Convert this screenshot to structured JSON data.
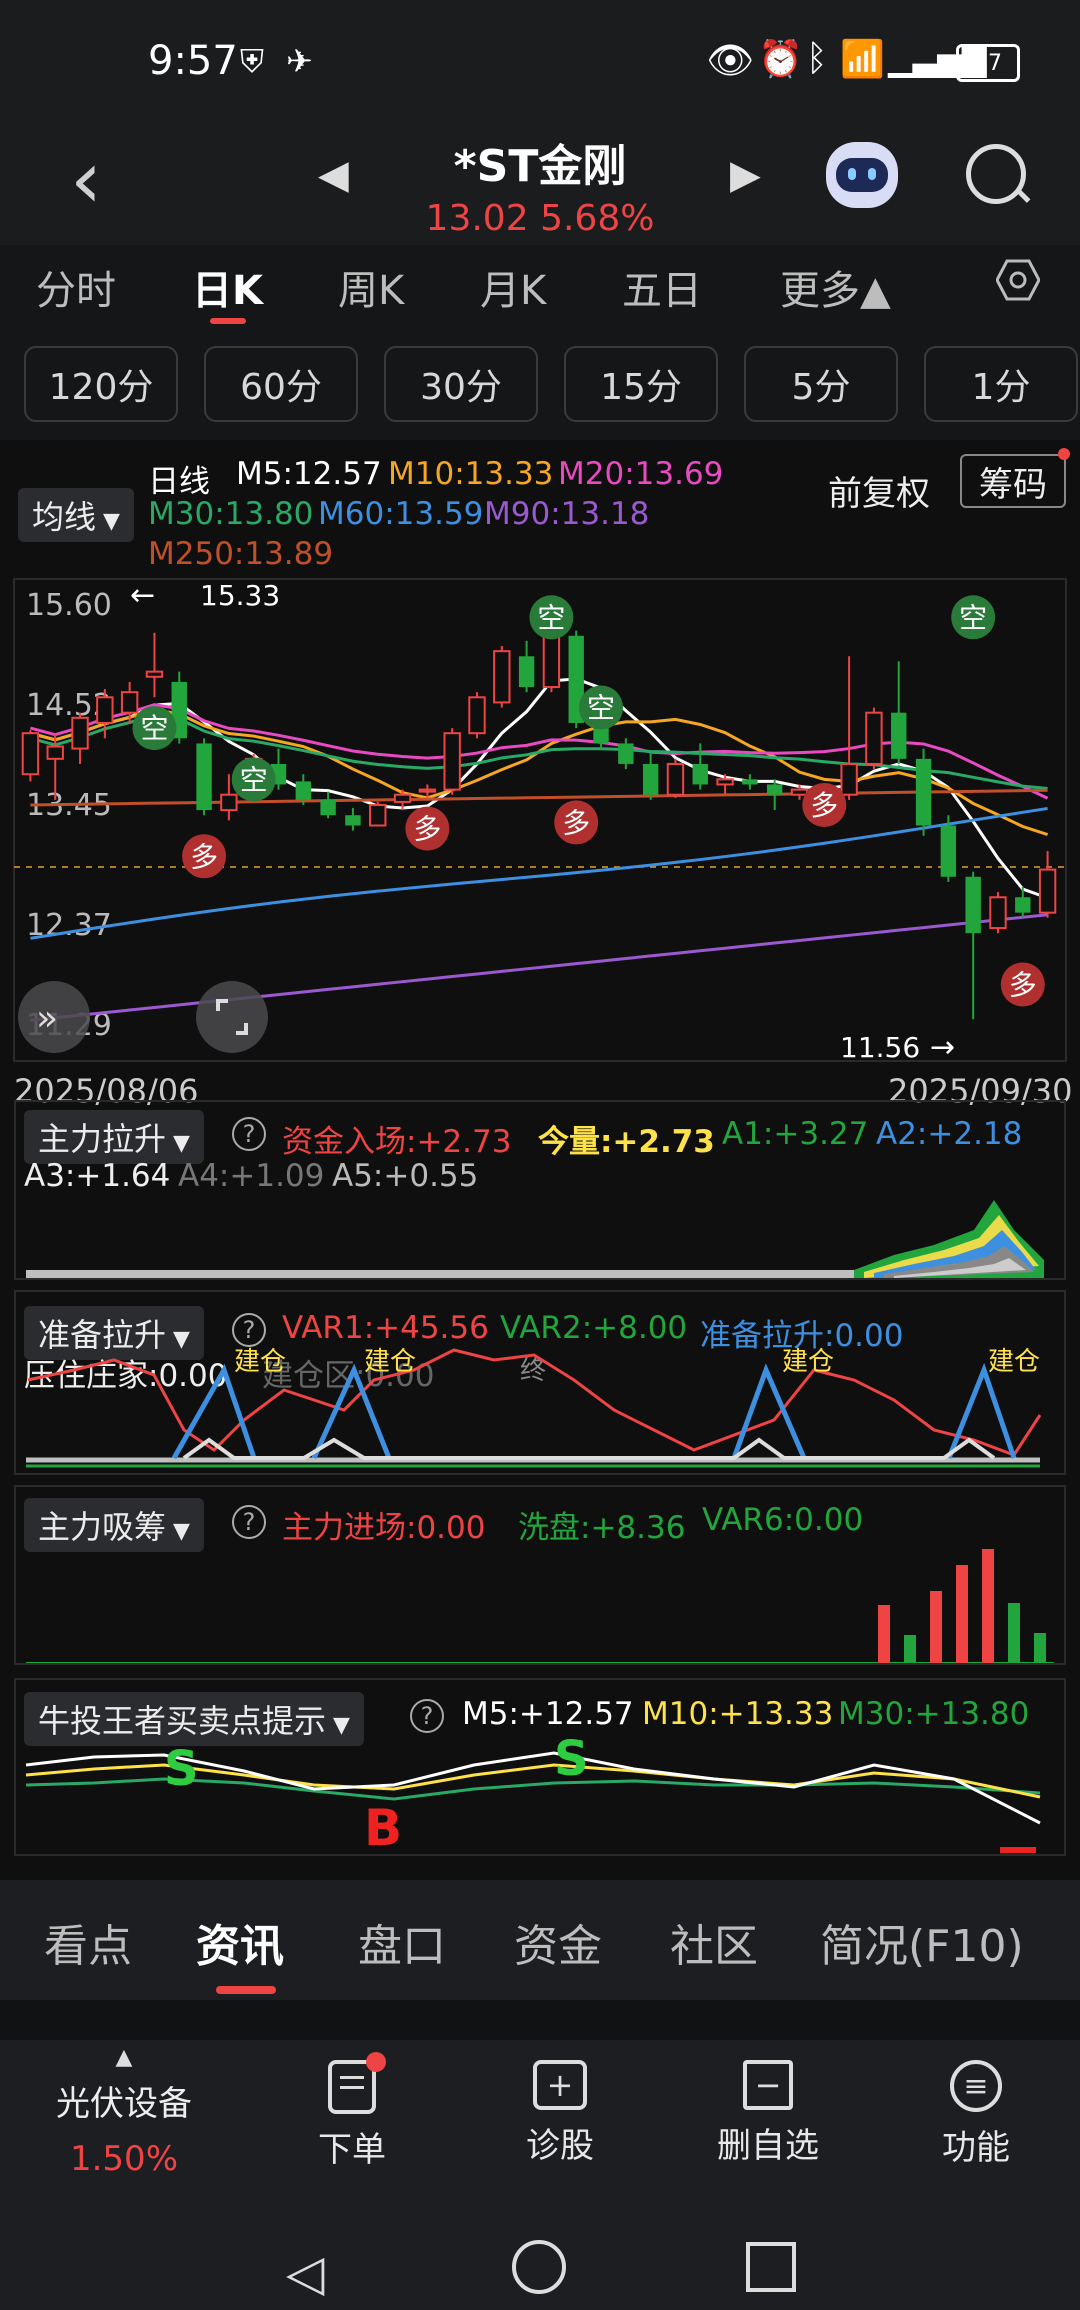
{
  "status_bar": {
    "time": "9:57",
    "battery": "67"
  },
  "header": {
    "stock_name": "*ST金刚",
    "price": "13.02",
    "change_pct": "5.68%",
    "price_color": "#ef4444"
  },
  "tabs": [
    "分时",
    "日K",
    "周K",
    "月K",
    "五日",
    "更多▲"
  ],
  "periods": [
    "120分",
    "60分",
    "30分",
    "15分",
    "5分",
    "1分"
  ],
  "main_chart": {
    "ma_selector": "均线",
    "line_name": "日线",
    "m5": "M5:12.57",
    "m10": "M10:13.33",
    "m20": "M20:13.69",
    "m30": "M30:13.80",
    "m60": "M60:13.59",
    "m90": "M90:13.18",
    "m250": "M250:13.89",
    "adjust": "前复权",
    "chips": "筹码",
    "y_ticks": [
      "15.60",
      "14.52",
      "13.45",
      "12.37",
      "11.29"
    ],
    "high_label": "15.33",
    "low_label": "11.56",
    "date_start": "2025/08/06",
    "date_end": "2025/09/30",
    "badge_kong": "空",
    "badge_duo": "多",
    "colors": {
      "m5": "#ffffff",
      "m10": "#f5a623",
      "m20": "#e84ac1",
      "m30": "#2aa866",
      "m60": "#3d8fe0",
      "m90": "#9b59d0",
      "m250": "#c0502a",
      "up": "#ef4444",
      "down": "#22a53c"
    }
  },
  "chart_data": {
    "type": "candlestick",
    "x_start": "2025/08/06",
    "x_end": "2025/09/30",
    "ylim": [
      11.29,
      15.6
    ],
    "candles": [
      [
        13.95,
        14.35,
        13.88,
        14.38
      ],
      [
        14.1,
        14.22,
        13.7,
        14.35
      ],
      [
        14.2,
        14.5,
        14.05,
        14.55
      ],
      [
        14.45,
        14.7,
        14.3,
        14.78
      ],
      [
        14.55,
        14.75,
        14.45,
        14.85
      ],
      [
        14.9,
        14.95,
        14.7,
        15.33
      ],
      [
        14.85,
        14.3,
        14.25,
        14.95
      ],
      [
        14.25,
        13.6,
        13.55,
        14.3
      ],
      [
        13.6,
        13.75,
        13.5,
        13.95
      ],
      [
        13.75,
        14.1,
        13.7,
        14.15
      ],
      [
        14.05,
        13.85,
        13.8,
        14.2
      ],
      [
        13.88,
        13.7,
        13.65,
        13.95
      ],
      [
        13.7,
        13.55,
        13.52,
        13.78
      ],
      [
        13.55,
        13.45,
        13.4,
        13.62
      ],
      [
        13.45,
        13.65,
        13.44,
        13.68
      ],
      [
        13.68,
        13.75,
        13.6,
        13.8
      ],
      [
        13.78,
        13.8,
        13.7,
        13.85
      ],
      [
        13.8,
        14.35,
        13.75,
        14.4
      ],
      [
        14.35,
        14.7,
        14.3,
        14.75
      ],
      [
        14.65,
        15.15,
        14.6,
        15.2
      ],
      [
        15.1,
        14.8,
        14.75,
        15.25
      ],
      [
        14.8,
        15.3,
        14.75,
        15.35
      ],
      [
        15.3,
        14.45,
        14.4,
        15.35
      ],
      [
        14.45,
        14.25,
        14.2,
        14.55
      ],
      [
        14.25,
        14.05,
        14.0,
        14.3
      ],
      [
        14.05,
        13.75,
        13.7,
        14.15
      ],
      [
        13.75,
        14.05,
        13.72,
        14.1
      ],
      [
        14.05,
        13.85,
        13.8,
        14.25
      ],
      [
        13.85,
        13.9,
        13.75,
        13.95
      ],
      [
        13.9,
        13.85,
        13.8,
        13.95
      ],
      [
        13.85,
        13.75,
        13.6,
        13.9
      ],
      [
        13.75,
        13.8,
        13.7,
        13.85
      ],
      [
        13.8,
        13.75,
        13.68,
        13.85
      ],
      [
        13.75,
        14.05,
        13.7,
        15.1
      ],
      [
        14.05,
        14.55,
        14.0,
        14.6
      ],
      [
        14.55,
        14.1,
        14.05,
        15.05
      ],
      [
        14.1,
        13.45,
        13.35,
        14.2
      ],
      [
        13.45,
        12.95,
        12.9,
        13.55
      ],
      [
        12.95,
        12.4,
        11.56,
        13.0
      ],
      [
        12.45,
        12.75,
        12.4,
        12.8
      ],
      [
        12.75,
        12.6,
        12.55,
        12.85
      ],
      [
        12.6,
        13.02,
        12.55,
        13.2
      ]
    ],
    "kong_markers": 5,
    "duo_markers": 5
  },
  "panel_zhuli": {
    "label": "主力拉升",
    "v1": "资金入场:+2.73",
    "v2": "今量:+2.73",
    "v3": "A1:+3.27",
    "v4": "A2:+2.18",
    "v5": "A3:+1.64",
    "v6": "A4:+1.09",
    "v7": "A5:+0.55"
  },
  "panel_zhunbei": {
    "label": "准备拉升",
    "v1": "VAR1:+45.56",
    "v2": "VAR2:+8.00",
    "v3": "准备拉升:0.00",
    "v4": "压住庄家:0.00",
    "v5": "建仓区:0.00",
    "v6": "终",
    "signal": "建仓"
  },
  "panel_xichou": {
    "label": "主力吸筹",
    "v1": "主力进场:0.00",
    "v2": "洗盘:+8.36",
    "v3": "VAR6:0.00"
  },
  "panel_niutou": {
    "label": "牛投王者买卖点提示",
    "v1": "M5:+12.57",
    "v2": "M10:+13.33",
    "v3": "M30:+13.80",
    "buy": "B",
    "sell": "S"
  },
  "bottom_tabs": [
    "看点",
    "资讯",
    "盘口",
    "资金",
    "社区",
    "简况(F10)"
  ],
  "dock": {
    "sector": "光伏设备",
    "sector_pct": "1.50%",
    "order": "下单",
    "diagnose": "诊股",
    "remove": "删自选",
    "functions": "功能"
  }
}
